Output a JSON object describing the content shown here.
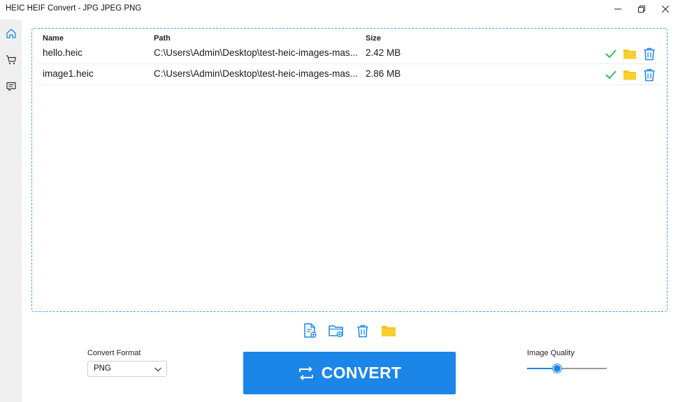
{
  "window": {
    "title": "HEIC HEIF Convert - JPG JPEG PNG",
    "controls": [
      "minimize-icon",
      "restore-icon",
      "close-icon"
    ]
  },
  "sidebar": {
    "items": [
      {
        "icon": "home-icon",
        "active": true
      },
      {
        "icon": "cart-icon",
        "active": false
      },
      {
        "icon": "feedback-icon",
        "active": false
      }
    ]
  },
  "file_list": {
    "columns": {
      "name": "Name",
      "path": "Path",
      "size": "Size"
    },
    "rows": [
      {
        "name": "hello.heic",
        "path": "C:\\Users\\Admin\\Desktop\\test-heic-images-mas...",
        "size": "2.42 MB",
        "status_icon": "check-icon"
      },
      {
        "name": "image1.heic",
        "path": "C:\\Users\\Admin\\Desktop\\test-heic-images-mas...",
        "size": "2.86 MB",
        "status_icon": "check-icon"
      }
    ]
  },
  "toolbar": {
    "items": [
      "add-file-icon",
      "add-folder-icon",
      "delete-all-icon",
      "open-folder-icon"
    ]
  },
  "convert_format": {
    "label": "Convert Format",
    "value": "PNG"
  },
  "convert_button": {
    "label": "CONVERT",
    "icon": "convert-arrows-icon"
  },
  "image_quality": {
    "label": "Image Quality",
    "value": 0.38
  },
  "colors": {
    "accent": "#1b86e8",
    "folder": "#f5c518",
    "check": "#2ebd6b",
    "dashed_border": "#4aa0e6"
  }
}
